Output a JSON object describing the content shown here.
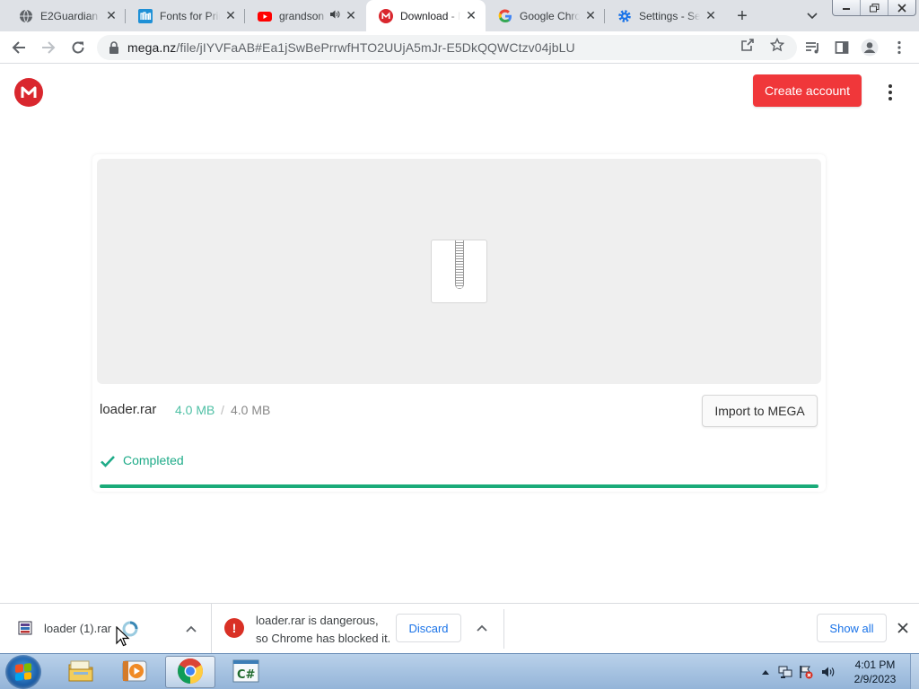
{
  "tabs": [
    {
      "title": "E2Guardian",
      "icon": "globe-icon",
      "active": false
    },
    {
      "title": "Fonts for Print",
      "icon": "fonts-site-icon",
      "active": false
    },
    {
      "title": "grandson",
      "icon": "youtube-icon",
      "active": false,
      "audio": true
    },
    {
      "title": "Download - MEGA",
      "icon": "mega-icon",
      "active": true
    },
    {
      "title": "Google Chrome",
      "icon": "google-icon",
      "active": false
    },
    {
      "title": "Settings - Security",
      "icon": "settings-icon",
      "active": false
    }
  ],
  "newtab_glyph": "+",
  "omnibox": {
    "domain": "mega.nz",
    "path": "/file/jIYVFaAB#Ea1jSwBePrrwfHTO2UUjA5mJr-E5DkQQWCtzv04jbLU"
  },
  "page": {
    "logo_letter": "M",
    "create_account_label": "Create account",
    "file": {
      "name": "loader.rar",
      "downloaded": "4.0 MB",
      "separator": "/",
      "total": "4.0 MB",
      "status": "Completed",
      "progress": 1.0
    },
    "import_label": "Import to MEGA"
  },
  "download_shelf": {
    "item_name": "loader (1).rar",
    "warning_line1": "loader.rar is dangerous,",
    "warning_line2": "so Chrome has blocked it.",
    "discard_label": "Discard",
    "show_all_label": "Show all"
  },
  "taskbar": {
    "apps": [
      "explorer-icon",
      "media-player-icon",
      "chrome-icon",
      "csharp-ide-icon"
    ],
    "active_app": "chrome-icon",
    "time": "4:01 PM",
    "date": "2/9/2023"
  },
  "colors": {
    "mega_red": "#d9272e",
    "create_button": "#f0373a",
    "progress_green": "#1aab79",
    "completed_text": "#1eab88",
    "chrome_blue": "#1a73e8",
    "danger_red": "#d93025"
  }
}
